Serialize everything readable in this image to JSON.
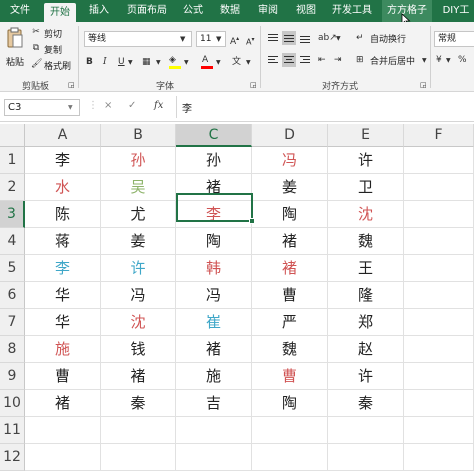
{
  "ribbon": {
    "tabs": [
      "文件",
      "开始",
      "插入",
      "页面布局",
      "公式",
      "数据",
      "审阅",
      "视图",
      "开发工具",
      "方方格子",
      "DIY工"
    ],
    "active_tab_index": 1,
    "hover_tab_index": 9,
    "clipboard": {
      "paste": "粘贴",
      "cut": "剪切",
      "copy": "复制",
      "format_painter": "格式刷",
      "group": "剪贴板"
    },
    "font": {
      "name": "等线",
      "size": "11",
      "group": "字体"
    },
    "alignment": {
      "wrap": "自动换行",
      "merge": "合并后居中",
      "group": "对齐方式"
    },
    "number": {
      "format": "常规"
    }
  },
  "formula_bar": {
    "name_box": "C3",
    "cancel": "×",
    "enter": "✓",
    "fx": "fx",
    "content": "李"
  },
  "grid": {
    "columns": [
      "A",
      "B",
      "C",
      "D",
      "E",
      "F"
    ],
    "selected_column": "C",
    "rows": [
      "1",
      "2",
      "3",
      "4",
      "5",
      "6",
      "7",
      "8",
      "9",
      "10",
      "11",
      "12"
    ],
    "selected_row": "3",
    "cells": [
      [
        {
          "text": "李",
          "color": "#222222"
        },
        {
          "text": "孙",
          "color": "#d05454"
        },
        {
          "text": "孙",
          "color": "#222222"
        },
        {
          "text": "冯",
          "color": "#d05454"
        },
        {
          "text": "许",
          "color": "#222222"
        }
      ],
      [
        {
          "text": "水",
          "color": "#d05454"
        },
        {
          "text": "吴",
          "color": "#8db36a"
        },
        {
          "text": "褚",
          "color": "#222222"
        },
        {
          "text": "姜",
          "color": "#222222"
        },
        {
          "text": "卫",
          "color": "#222222"
        }
      ],
      [
        {
          "text": "陈",
          "color": "#222222"
        },
        {
          "text": "尤",
          "color": "#222222"
        },
        {
          "text": "李",
          "color": "#d05454"
        },
        {
          "text": "陶",
          "color": "#222222"
        },
        {
          "text": "沈",
          "color": "#d05454"
        }
      ],
      [
        {
          "text": "蒋",
          "color": "#222222"
        },
        {
          "text": "姜",
          "color": "#222222"
        },
        {
          "text": "陶",
          "color": "#222222"
        },
        {
          "text": "褚",
          "color": "#222222"
        },
        {
          "text": "魏",
          "color": "#222222"
        }
      ],
      [
        {
          "text": "李",
          "color": "#3fa7c8"
        },
        {
          "text": "许",
          "color": "#3fa7c8"
        },
        {
          "text": "韩",
          "color": "#d05454"
        },
        {
          "text": "褚",
          "color": "#d05454"
        },
        {
          "text": "王",
          "color": "#222222"
        }
      ],
      [
        {
          "text": "华",
          "color": "#222222"
        },
        {
          "text": "冯",
          "color": "#222222"
        },
        {
          "text": "冯",
          "color": "#222222"
        },
        {
          "text": "曹",
          "color": "#222222"
        },
        {
          "text": "隆",
          "color": "#222222"
        }
      ],
      [
        {
          "text": "华",
          "color": "#222222"
        },
        {
          "text": "沈",
          "color": "#d05454"
        },
        {
          "text": "崔",
          "color": "#3fa7c8"
        },
        {
          "text": "严",
          "color": "#222222"
        },
        {
          "text": "郑",
          "color": "#222222"
        }
      ],
      [
        {
          "text": "施",
          "color": "#d05454"
        },
        {
          "text": "钱",
          "color": "#222222"
        },
        {
          "text": "褚",
          "color": "#222222"
        },
        {
          "text": "魏",
          "color": "#222222"
        },
        {
          "text": "赵",
          "color": "#222222"
        }
      ],
      [
        {
          "text": "曹",
          "color": "#222222"
        },
        {
          "text": "褚",
          "color": "#222222"
        },
        {
          "text": "施",
          "color": "#222222"
        },
        {
          "text": "曹",
          "color": "#d05454"
        },
        {
          "text": "许",
          "color": "#222222"
        }
      ],
      [
        {
          "text": "褚",
          "color": "#222222"
        },
        {
          "text": "秦",
          "color": "#222222"
        },
        {
          "text": "吉",
          "color": "#222222"
        },
        {
          "text": "陶",
          "color": "#222222"
        },
        {
          "text": "秦",
          "color": "#222222"
        }
      ]
    ]
  },
  "colors": {
    "accent": "#217346",
    "font_color_bar": "#ff0000",
    "fill_color_bar": "#ffff00"
  }
}
